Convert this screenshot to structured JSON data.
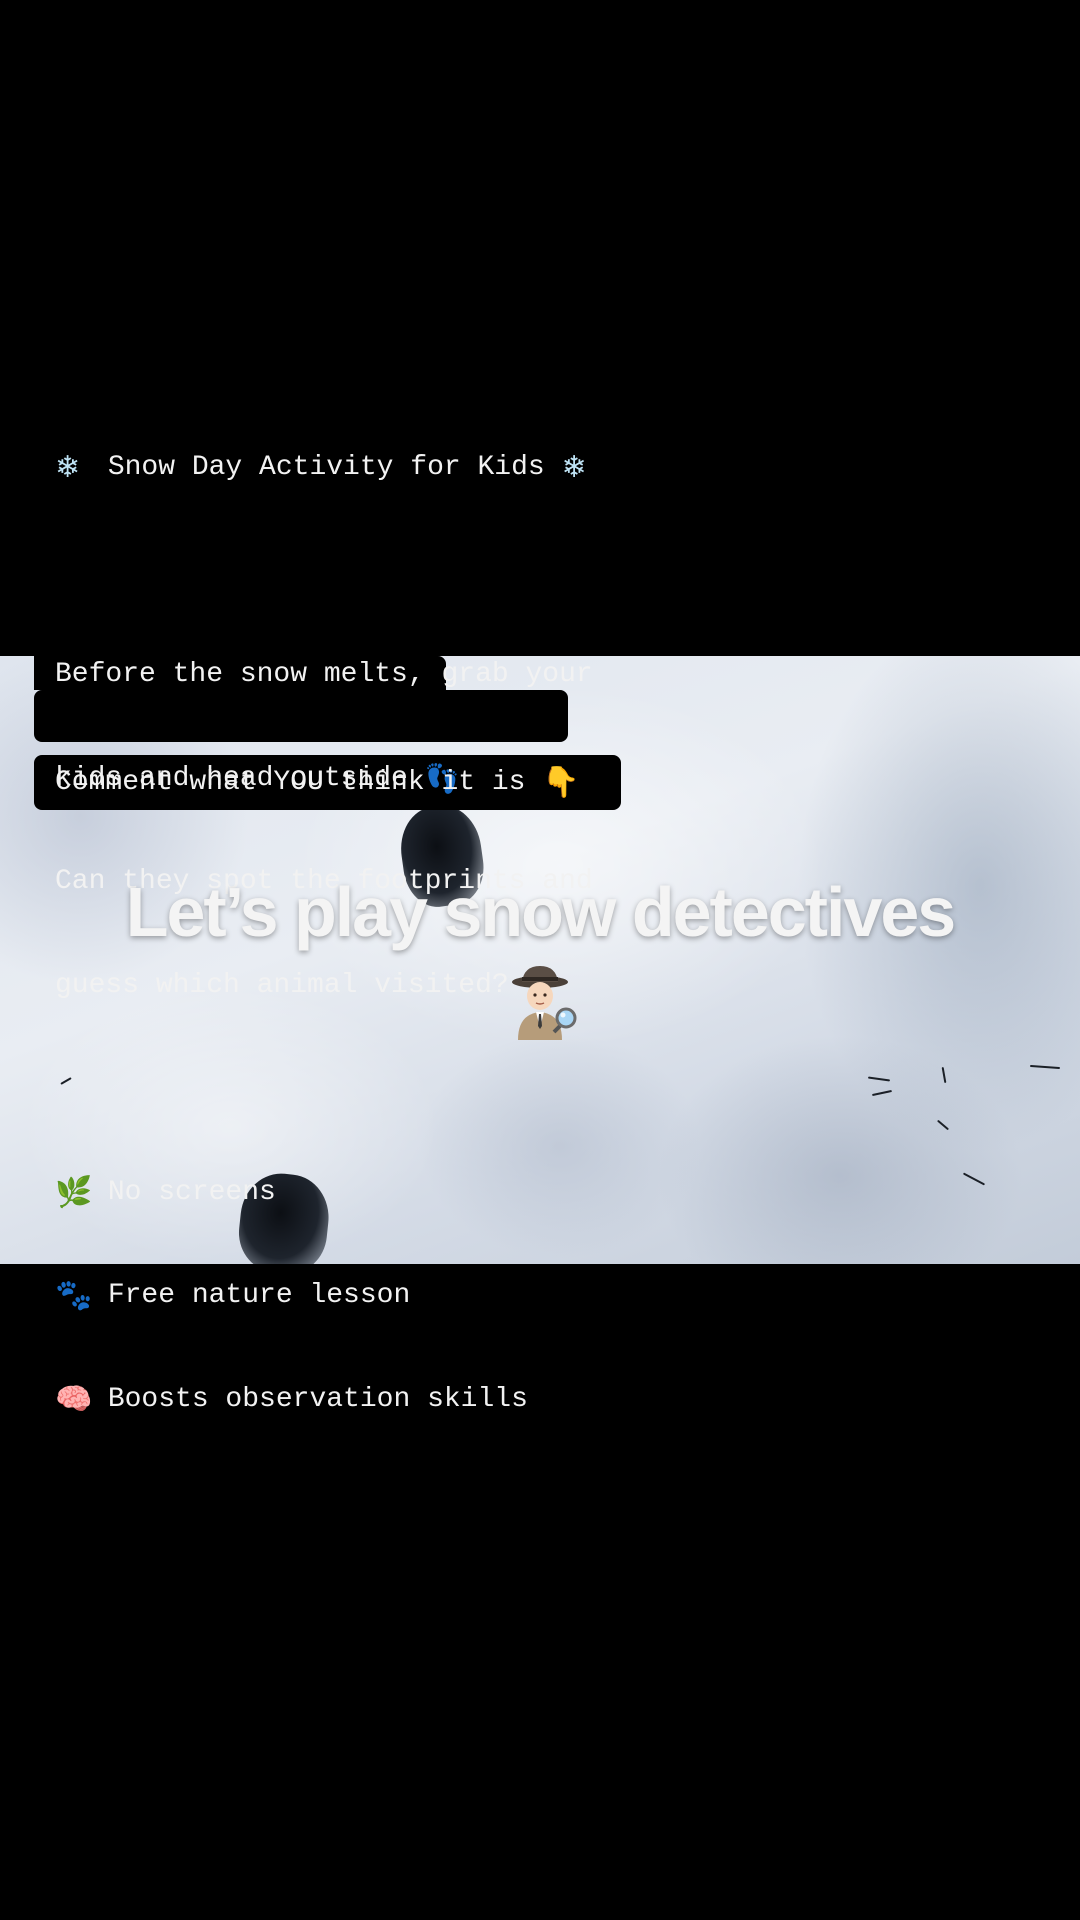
{
  "caption": {
    "title_line": "Snow Day Activity for Kids",
    "paragraph_lines": [
      "Before the snow melts, grab your",
      "kids and head outside",
      "Can they spot the footprints and",
      "guess which animal visited?"
    ],
    "bullets": [
      {
        "icon": "herb-icon",
        "glyph": "🌿",
        "label": "No screens"
      },
      {
        "icon": "paw-prints-icon",
        "glyph": "🐾",
        "label": "Free nature lesson"
      },
      {
        "icon": "brain-icon",
        "glyph": "🧠",
        "label": "Boosts observation skills"
      }
    ],
    "comment_line": "Comment what YOU think it is",
    "icons": {
      "snowflake": "❄",
      "footprints": "👣",
      "pointing_down": "👇"
    }
  },
  "overlay": {
    "title": "Let’s play snow detectives"
  },
  "colors": {
    "background": "#000000",
    "text": "#f2f2f2",
    "snow_light": "#e9edf3",
    "snow_shadow": "#c3ccd9"
  }
}
